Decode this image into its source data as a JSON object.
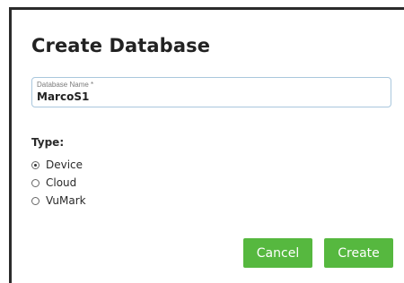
{
  "dialog": {
    "title": "Create Database",
    "field": {
      "label": "Database Name *",
      "value": "MarcoS1"
    },
    "type_label": "Type:",
    "options": [
      {
        "label": "Device",
        "checked": true
      },
      {
        "label": "Cloud",
        "checked": false
      },
      {
        "label": "VuMark",
        "checked": false
      }
    ],
    "buttons": {
      "cancel": "Cancel",
      "create": "Create"
    }
  },
  "colors": {
    "button_green": "#56b83f",
    "field_border": "#a9c7dd",
    "frame_border": "#2b2b2b"
  }
}
